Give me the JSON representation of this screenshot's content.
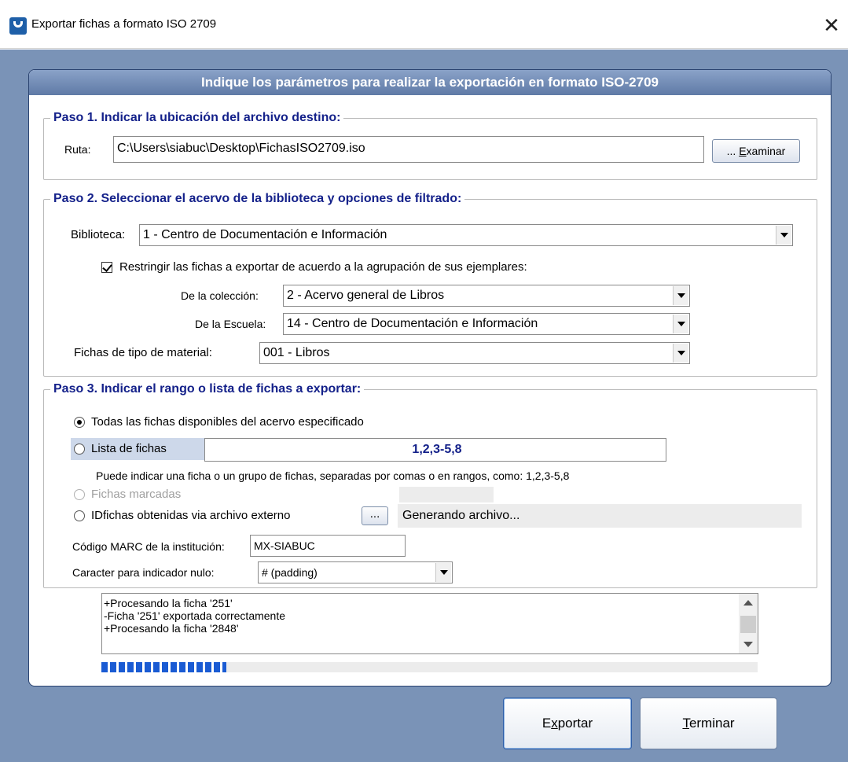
{
  "window": {
    "title": "Exportar fichas a formato ISO 2709",
    "close_label": "✕"
  },
  "panel": {
    "header": "Indique los parámetros para realizar la exportación en formato ISO-2709"
  },
  "step1": {
    "title": "Paso 1. Indicar la ubicación del archivo destino:",
    "route_label": "Ruta:",
    "route_value": "C:\\Users\\siabuc\\Desktop\\FichasISO2709.iso",
    "browse_prefix": "... ",
    "browse_mnemonic": "E",
    "browse_rest": "xaminar"
  },
  "step2": {
    "title": "Paso 2. Seleccionar el acervo de la biblioteca y opciones de filtrado:",
    "library_label": "Biblioteca:",
    "library_value": "1 - Centro de Documentación e Información",
    "restrict_label": "Restringir las fichas a exportar de acuerdo a la agrupación de sus ejemplares:",
    "restrict_checked": true,
    "collection_label": "De la colección:",
    "collection_value": "2 - Acervo general de Libros",
    "school_label": "De la Escuela:",
    "school_value": "14 - Centro de Documentación e Información",
    "material_label": "Fichas de tipo de material:",
    "material_value": "001 - Libros"
  },
  "step3": {
    "title": "Paso 3. Indicar el rango o lista de fichas a exportar:",
    "option_all": "Todas las fichas disponibles del acervo especificado",
    "option_list": "Lista de fichas",
    "list_value": "1,2,3-5,8",
    "list_hint": "Puede indicar una ficha o un grupo de fichas, separadas por comas o en rangos, como: 1,2,3-5,8",
    "option_marked": "Fichas marcadas",
    "option_external": "IDfichas obtenidas via archivo externo",
    "external_button": "...",
    "external_status": "Generando archivo...",
    "marc_label": "Código MARC de la institución:",
    "marc_value": "MX-SIABUC",
    "null_label": "Caracter para indicador nulo:",
    "null_value": "# (padding)",
    "selected_option": "all"
  },
  "log": {
    "lines": [
      "+Procesando la ficha '251'",
      " -Ficha '251' exportada correctamente",
      "+Procesando la ficha '2848'"
    ]
  },
  "progress": {
    "fraction": 0.19
  },
  "buttons": {
    "export_pre": "E",
    "export_mnemonic": "x",
    "export_post": "portar",
    "finish_mnemonic": "T",
    "finish_post": "erminar"
  }
}
